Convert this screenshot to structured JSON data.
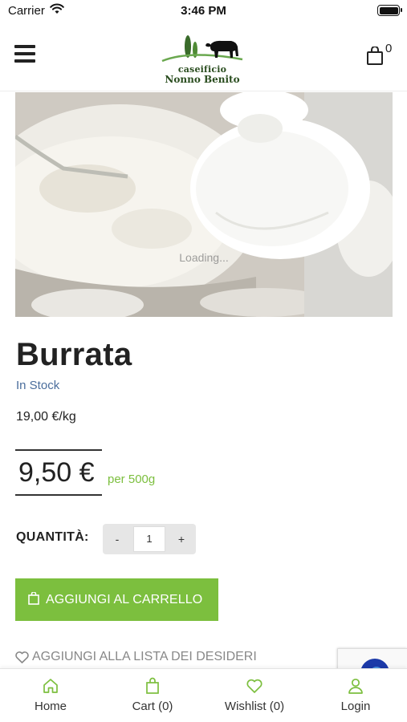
{
  "status_bar": {
    "carrier": "Carrier",
    "time": "3:46 PM"
  },
  "header": {
    "logo_line1": "caseificio",
    "logo_line2": "Nonno Benito",
    "cart_count": "0"
  },
  "product": {
    "image_overlay": "Loading...",
    "title": "Burrata",
    "stock": "In Stock",
    "unit_price": "19,00 €/kg",
    "price": "9,50 €",
    "per": "per 500g",
    "quantity_label": "QUANTITÀ:",
    "quantity": {
      "minus": "-",
      "value": "1",
      "plus": "+"
    },
    "add_to_cart": "AGGIUNGI AL CARRELLO",
    "add_to_wishlist": "AGGIUNGI ALLA LISTA DEI DESIDERI"
  },
  "bottom_nav": [
    {
      "label": "Home",
      "icon": "home-icon"
    },
    {
      "label": "Cart (0)",
      "icon": "bag-icon"
    },
    {
      "label": "Wishlist (0)",
      "icon": "heart-icon"
    },
    {
      "label": "Login",
      "icon": "user-icon"
    }
  ],
  "colors": {
    "accent_green": "#7cbf3e",
    "stock_blue": "#4a6d9c",
    "text": "#222222"
  }
}
